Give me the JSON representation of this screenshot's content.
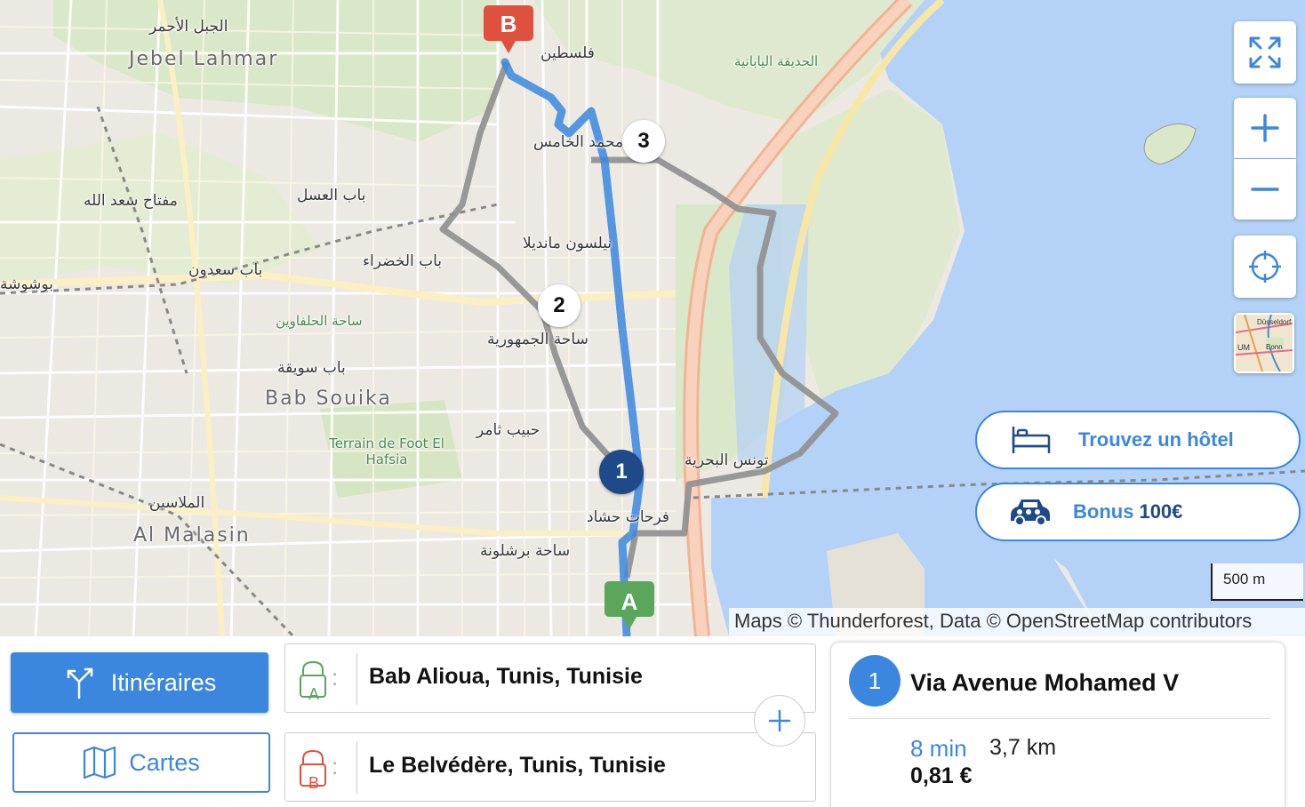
{
  "map": {
    "labels": {
      "jebel_lahmar_ar": "الجبل الأحمر",
      "jebel_lahmar": "Jebel Lahmar",
      "filastin": "فلسطين",
      "japanese_garden": "الحديقة اليابانية",
      "mohamed_v": "محمد الخامس",
      "bab_el_assal": "باب العسل",
      "miftah_saadallah": "مفتاح سعد الله",
      "nelson_mandela": "نيلسون مانديلا",
      "bab_el_khadra": "باب الخضراء",
      "bab_saadoun": "باب سعدون",
      "bouchoucha": "بوشوشة",
      "halfaouine": "ساحة الحلفاوين",
      "place_republique": "ساحة الجمهورية",
      "bab_souika_ar": "باب سويقة",
      "bab_souika": "Bab Souika",
      "habib_thameur": "حبيب ثامر",
      "terrain_foot": "Terrain de Foot El Hafsia",
      "tunis_marine": "تونس البحرية",
      "farhat_hached": "فرحات حشاد",
      "malassine_ar": "الملاسين",
      "al_malasin": "Al Malasin",
      "place_barcelone": "ساحة برشلونة"
    },
    "markers": {
      "start": "A",
      "end": "B"
    },
    "waypoints": [
      "1",
      "2",
      "3"
    ],
    "thumbnail_labels": {
      "a": "Düsseldorf",
      "b": "UM",
      "c": "Bonn"
    },
    "controls": {
      "fullscreen_icon": "expand-arrows-icon",
      "zoom_in": "+",
      "zoom_out": "−",
      "locate_icon": "crosshair-icon",
      "layers_icon": "map-thumbnail"
    },
    "promos": {
      "hotel": {
        "label": "Trouvez un hôtel",
        "icon": "bed-icon"
      },
      "bonus": {
        "label_prefix": "Bonus ",
        "amount": "100€",
        "icon": "car-icon"
      }
    },
    "scale": "500 m",
    "attribution": "Maps © Thunderforest, Data © OpenStreetMap contributors",
    "colors": {
      "route_active": "#3b87e0",
      "route_alt": "#8a8a8a",
      "water": "#b4d2f7",
      "marker_start": "#5aa65a",
      "marker_end": "#e0503f"
    }
  },
  "panel": {
    "itineraries_label": "Itinéraires",
    "maps_label": "Cartes",
    "from": {
      "pin": "A",
      "value": "Bab Alioua, Tunis, Tunisie"
    },
    "to": {
      "pin": "B",
      "value": "Le Belvédère, Tunis, Tunisie"
    },
    "add_waypoint": "+",
    "route": {
      "number": "1",
      "title": "Via Avenue Mohamed V",
      "duration": "8 min",
      "distance": "3,7 km",
      "price": "0,81 €"
    }
  }
}
